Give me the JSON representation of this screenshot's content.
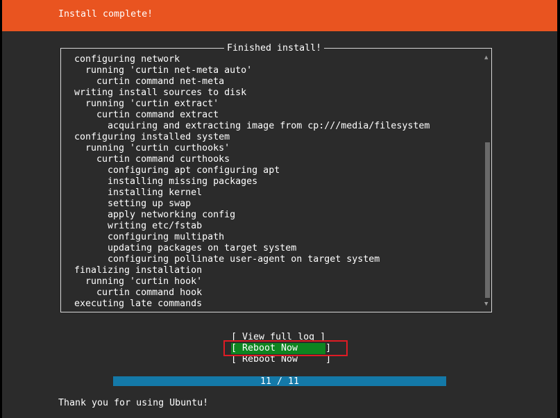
{
  "header": {
    "title": "Install complete!"
  },
  "log_panel": {
    "title": "Finished install!",
    "lines": [
      "configuring network",
      "  running 'curtin net-meta auto'",
      "    curtin command net-meta",
      "writing install sources to disk",
      "  running 'curtin extract'",
      "    curtin command extract",
      "      acquiring and extracting image from cp:///media/filesystem",
      "configuring installed system",
      "  running 'curtin curthooks'",
      "    curtin command curthooks",
      "      configuring apt configuring apt",
      "      installing missing packages",
      "      installing kernel",
      "      setting up swap",
      "      apply networking config",
      "      writing etc/fstab",
      "      configuring multipath",
      "      updating packages on target system",
      "      configuring pollinate user-agent on target system",
      "finalizing installation",
      "  running 'curtin hook'",
      "    curtin command hook",
      "executing late commands"
    ],
    "scroll_up_icon": "triangle-up-icon",
    "scroll_down_icon": "triangle-down-icon"
  },
  "buttons": {
    "view_log": "[ View full log ]",
    "reboot_selected": "[ Reboot Now     ]",
    "reboot": "[ Reboot Now     ]"
  },
  "progress": {
    "label": "11 / 11",
    "fraction": 1.0
  },
  "footer": {
    "text": "Thank you for using Ubuntu!"
  },
  "colors": {
    "header_bg": "#e95420",
    "panel_bg": "#2b2b2b",
    "selected_button_bg": "#0e8420",
    "progress_bg": "#1479a8",
    "highlight_border": "#e01b24"
  }
}
